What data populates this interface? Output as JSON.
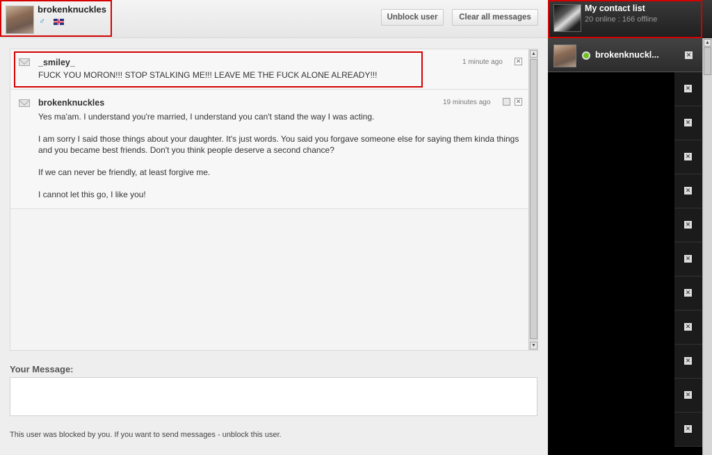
{
  "header": {
    "user_name": "brokenknuckles",
    "gender_icon": "male-symbol-icon",
    "flag_icon": "uk-flag-icon",
    "unblock_label": "Unblock user",
    "clear_label": "Clear all messages"
  },
  "messages": [
    {
      "author": "_smiley_",
      "time": "1 minute ago",
      "text": "FUCK YOU MORON!!! STOP STALKING ME!!! LEAVE ME THE FUCK ALONE ALREADY!!!"
    },
    {
      "author": "brokenknuckles",
      "time": "19 minutes ago",
      "paragraphs": [
        "Yes ma'am. I understand you're married, I understand you can't stand the way I was acting.",
        "I am sorry I said those things about your daughter. It's just words. You said you forgave someone else for saying them kinda things and you became best friends. Don't you think people deserve a second chance?",
        "If we can never be friendly, at least forgive me.",
        "I cannot let this go, I like you!"
      ]
    }
  ],
  "compose": {
    "label": "Your Message:",
    "blocked_note": "This user was blocked by you. If you want to send messages - unblock this user."
  },
  "contacts": {
    "title": "My contact list",
    "stats": "20 online : 166 offline",
    "active_contact": "brokenknuckl..."
  },
  "colors": {
    "highlight": "#d40000",
    "online": "#6ec21b"
  }
}
